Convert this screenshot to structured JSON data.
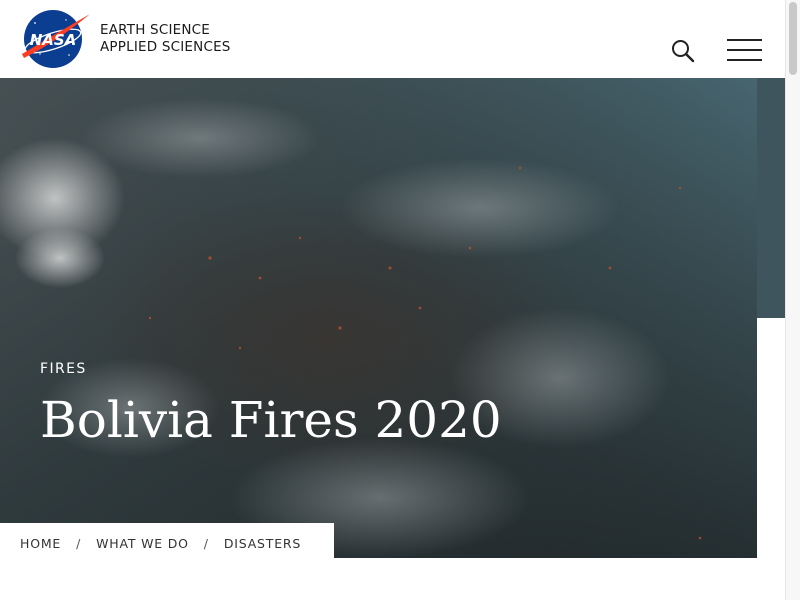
{
  "header": {
    "logo_text": "NASA",
    "site_name_line1": "EARTH SCIENCE",
    "site_name_line2": "APPLIED SCIENCES",
    "search_icon": "search-icon",
    "menu_icon": "hamburger-menu-icon"
  },
  "hero": {
    "category": "FIRES",
    "title": "Bolivia Fires 2020"
  },
  "breadcrumb": {
    "items": [
      "HOME",
      "WHAT WE DO",
      "DISASTERS"
    ],
    "separator": "/"
  },
  "colors": {
    "logo_blue": "#0b3d91",
    "logo_red": "#fc3d21",
    "hero_overlay": "#2b3236",
    "hero_corner": "#3e555d",
    "text_dark": "#1a1a1a"
  }
}
